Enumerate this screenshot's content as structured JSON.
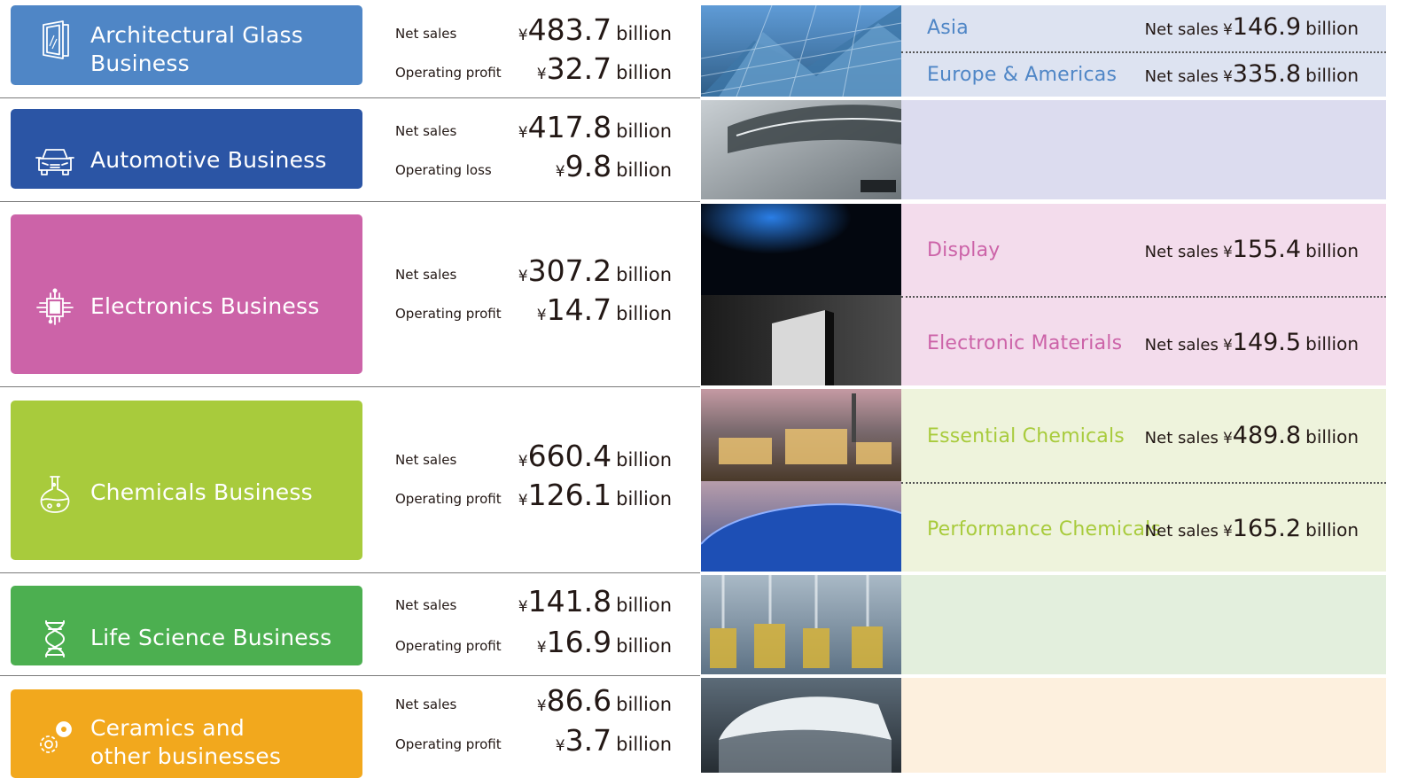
{
  "segments": [
    {
      "name": "Architectural Glass Business",
      "name_lines": [
        "Architectural Glass",
        "Business"
      ],
      "color": "#4f86c6",
      "icon": "glass-door-icon",
      "metrics": [
        {
          "label": "Net sales",
          "currency": "¥",
          "value": "483.7",
          "unit": "billion"
        },
        {
          "label": "Operating profit",
          "currency": "¥",
          "value": "32.7",
          "unit": "billion"
        }
      ],
      "panel_color": "#dde3f1",
      "sub_segments": [
        {
          "name": "Asia",
          "label": "Net sales",
          "currency": "¥",
          "value": "146.9",
          "unit": "billion",
          "color": "#4f86c6"
        },
        {
          "name": "Europe & Americas",
          "label": "Net sales",
          "currency": "¥",
          "value": "335.8",
          "unit": "billion",
          "color": "#4f86c6"
        }
      ]
    },
    {
      "name": "Automotive Business",
      "name_lines": [
        "Automotive Business"
      ],
      "color": "#2b55a5",
      "icon": "car-icon",
      "metrics": [
        {
          "label": "Net sales",
          "currency": "¥",
          "value": "417.8",
          "unit": "billion"
        },
        {
          "label": "Operating loss",
          "currency": "¥",
          "value": "9.8",
          "unit": "billion"
        }
      ],
      "panel_color": "#dcdcef",
      "sub_segments": []
    },
    {
      "name": "Electronics Business",
      "name_lines": [
        "Electronics Business"
      ],
      "color": "#cc63a8",
      "icon": "chip-icon",
      "metrics": [
        {
          "label": "Net sales",
          "currency": "¥",
          "value": "307.2",
          "unit": "billion"
        },
        {
          "label": "Operating profit",
          "currency": "¥",
          "value": "14.7",
          "unit": "billion"
        }
      ],
      "panel_color": "#f3dcec",
      "sub_segments": [
        {
          "name": "Display",
          "label": "Net sales",
          "currency": "¥",
          "value": "155.4",
          "unit": "billion",
          "color": "#cc63a8"
        },
        {
          "name": "Electronic Materials",
          "label": "Net sales",
          "currency": "¥",
          "value": "149.5",
          "unit": "billion",
          "color": "#cc63a8"
        }
      ]
    },
    {
      "name": "Chemicals Business",
      "name_lines": [
        "Chemicals Business"
      ],
      "color": "#a8cb3c",
      "icon": "flask-icon",
      "metrics": [
        {
          "label": "Net sales",
          "currency": "¥",
          "value": "660.4",
          "unit": "billion"
        },
        {
          "label": "Operating profit",
          "currency": "¥",
          "value": "126.1",
          "unit": "billion"
        }
      ],
      "panel_color": "#eef3dc",
      "sub_segments": [
        {
          "name": "Essential Chemicals",
          "label": "Net sales",
          "currency": "¥",
          "value": "489.8",
          "unit": "billion",
          "color": "#a8cb3c"
        },
        {
          "name": "Performance Chemicals",
          "label": "Net sales",
          "currency": "¥",
          "value": "165.2",
          "unit": "billion",
          "color": "#a8cb3c"
        }
      ]
    },
    {
      "name": "Life Science Business",
      "name_lines": [
        "Life Science Business"
      ],
      "color": "#4caf50",
      "icon": "dna-icon",
      "metrics": [
        {
          "label": "Net sales",
          "currency": "¥",
          "value": "141.8",
          "unit": "billion"
        },
        {
          "label": "Operating profit",
          "currency": "¥",
          "value": "16.9",
          "unit": "billion"
        }
      ],
      "panel_color": "#e3efdd",
      "sub_segments": []
    },
    {
      "name": "Ceramics and other businesses",
      "name_lines": [
        "Ceramics and",
        "other businesses"
      ],
      "color": "#f2a81d",
      "icon": "gears-icon",
      "metrics": [
        {
          "label": "Net sales",
          "currency": "¥",
          "value": "86.6",
          "unit": "billion"
        },
        {
          "label": "Operating profit",
          "currency": "¥",
          "value": "3.7",
          "unit": "billion"
        }
      ],
      "panel_color": "#fdf0de",
      "sub_segments": []
    }
  ]
}
